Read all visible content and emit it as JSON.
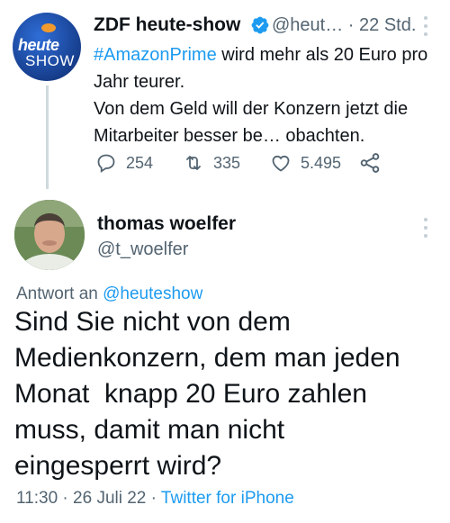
{
  "tweet1": {
    "author_name": "ZDF heute-show",
    "handle": "@heut…",
    "separator": "·",
    "time": "22 Std.",
    "avatar_text_1": "heute",
    "avatar_text_2": "SHOW",
    "hashtag": "#AmazonPrime",
    "text_after_hashtag": " wird mehr als 20 Euro pro Jahr teurer.",
    "text_line2": "Von dem Geld will der Konzern jetzt die Mitarbeiter besser be… obachten.",
    "replies": "254",
    "retweets": "335",
    "likes": "5.495"
  },
  "tweet2": {
    "author_name": "thomas woelfer",
    "handle": "@t_woelfer",
    "reply_prefix": "Antwort an",
    "reply_target": "@heuteshow",
    "text": "Sind Sie nicht von dem\nMedienkonzern, dem man jeden\nMonat  knapp 20 Euro zahlen\nmuss, damit man nicht\neingesperrt wird?",
    "time": "11:30",
    "separator": "·",
    "date": "26 Juli 22",
    "separator2": "·",
    "client": "Twitter for iPhone"
  },
  "colors": {
    "accent": "#1d9bf0",
    "muted": "#536471",
    "text": "#0f1419"
  },
  "icons": [
    "verified-icon",
    "more-icon",
    "reply-icon",
    "retweet-icon",
    "like-icon",
    "share-icon"
  ]
}
